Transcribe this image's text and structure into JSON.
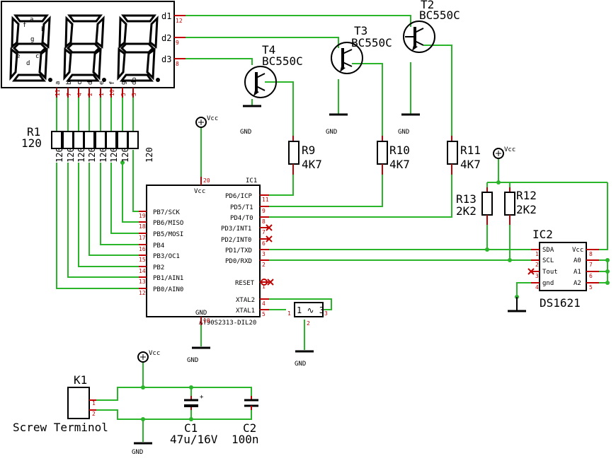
{
  "display": {
    "digit_pins": [
      "d1",
      "d2",
      "d3"
    ],
    "digit_pin_numbers": [
      "12",
      "9",
      "8"
    ],
    "segment_pins": [
      "a",
      "b",
      "c",
      "d",
      "e",
      "f",
      "g",
      "dp"
    ],
    "segment_pin_numbers": [
      "11",
      "7",
      "4",
      "2",
      "1",
      "10",
      "5",
      "3"
    ],
    "segment_letters": [
      "f",
      "a",
      "b",
      "g",
      "e",
      "c",
      "d"
    ]
  },
  "transistors": [
    {
      "name": "T2",
      "value": "BC550C"
    },
    {
      "name": "T3",
      "value": "BC550C"
    },
    {
      "name": "T4",
      "value": "BC550C"
    }
  ],
  "resistors": [
    {
      "name": "R9",
      "value": "4K7"
    },
    {
      "name": "R10",
      "value": "4K7"
    },
    {
      "name": "R11",
      "value": "4K7"
    },
    {
      "name": "R12",
      "value": "2K2"
    },
    {
      "name": "R13",
      "value": "2K2"
    }
  ],
  "r1": {
    "name": "R1",
    "value": "120",
    "values": [
      "120",
      "120",
      "120",
      "120",
      "120",
      "120",
      "120",
      "120"
    ]
  },
  "ic1": {
    "name": "IC1",
    "part": "AT90S2313-DIL20",
    "vcc_label": "Vcc",
    "gnd_label": "GND",
    "left_pins": [
      {
        "label": "PB7/SCK",
        "num": "19"
      },
      {
        "label": "PB6/MISO",
        "num": "18"
      },
      {
        "label": "PB5/MOSI",
        "num": "17"
      },
      {
        "label": "PB4",
        "num": "16"
      },
      {
        "label": "PB3/OC1",
        "num": "15"
      },
      {
        "label": "PB2",
        "num": "14"
      },
      {
        "label": "PB1/AIN1",
        "num": "13"
      },
      {
        "label": "PB0/AIN0",
        "num": "12"
      }
    ],
    "right_pins": [
      {
        "label": "PD6/ICP",
        "num": "11"
      },
      {
        "label": "PD5/T1",
        "num": "9"
      },
      {
        "label": "PD4/T0",
        "num": "8"
      },
      {
        "label": "PD3/INT1",
        "num": "7"
      },
      {
        "label": "PD2/INT0",
        "num": "6"
      },
      {
        "label": "PD1/TXD",
        "num": "3"
      },
      {
        "label": "PD0/RXD",
        "num": "2"
      },
      {
        "label": "RESET",
        "num": "1"
      },
      {
        "label": "XTAL2",
        "num": "4"
      },
      {
        "label": "XTAL1",
        "num": "5"
      }
    ],
    "vcc_pin": "20",
    "gnd_pin": "10"
  },
  "ic2": {
    "name": "IC2",
    "part": "DS1621",
    "left_pins": [
      {
        "label": "SDA",
        "num": "1"
      },
      {
        "label": "SCL",
        "num": "2"
      },
      {
        "label": "Tout",
        "num": "3"
      },
      {
        "label": "gnd",
        "num": "4"
      }
    ],
    "right_pins": [
      {
        "label": "Vcc",
        "num": "8"
      },
      {
        "label": "A0",
        "num": "7"
      },
      {
        "label": "A1",
        "num": "6"
      },
      {
        "label": "A2",
        "num": "5"
      }
    ]
  },
  "resonator": {
    "pins": [
      "1",
      "2",
      "3"
    ]
  },
  "power": {
    "vcc": "Vcc",
    "gnd": "GND"
  },
  "connector": {
    "name": "K1",
    "type": "Screw Terminol",
    "pins": [
      "1",
      "2"
    ]
  },
  "capacitors": [
    {
      "name": "C1",
      "value": "47u/16V"
    },
    {
      "name": "C2",
      "value": "100n"
    }
  ],
  "colors": {
    "wire": "#2bb52b",
    "pin": "#c00000",
    "body": "#000000"
  }
}
